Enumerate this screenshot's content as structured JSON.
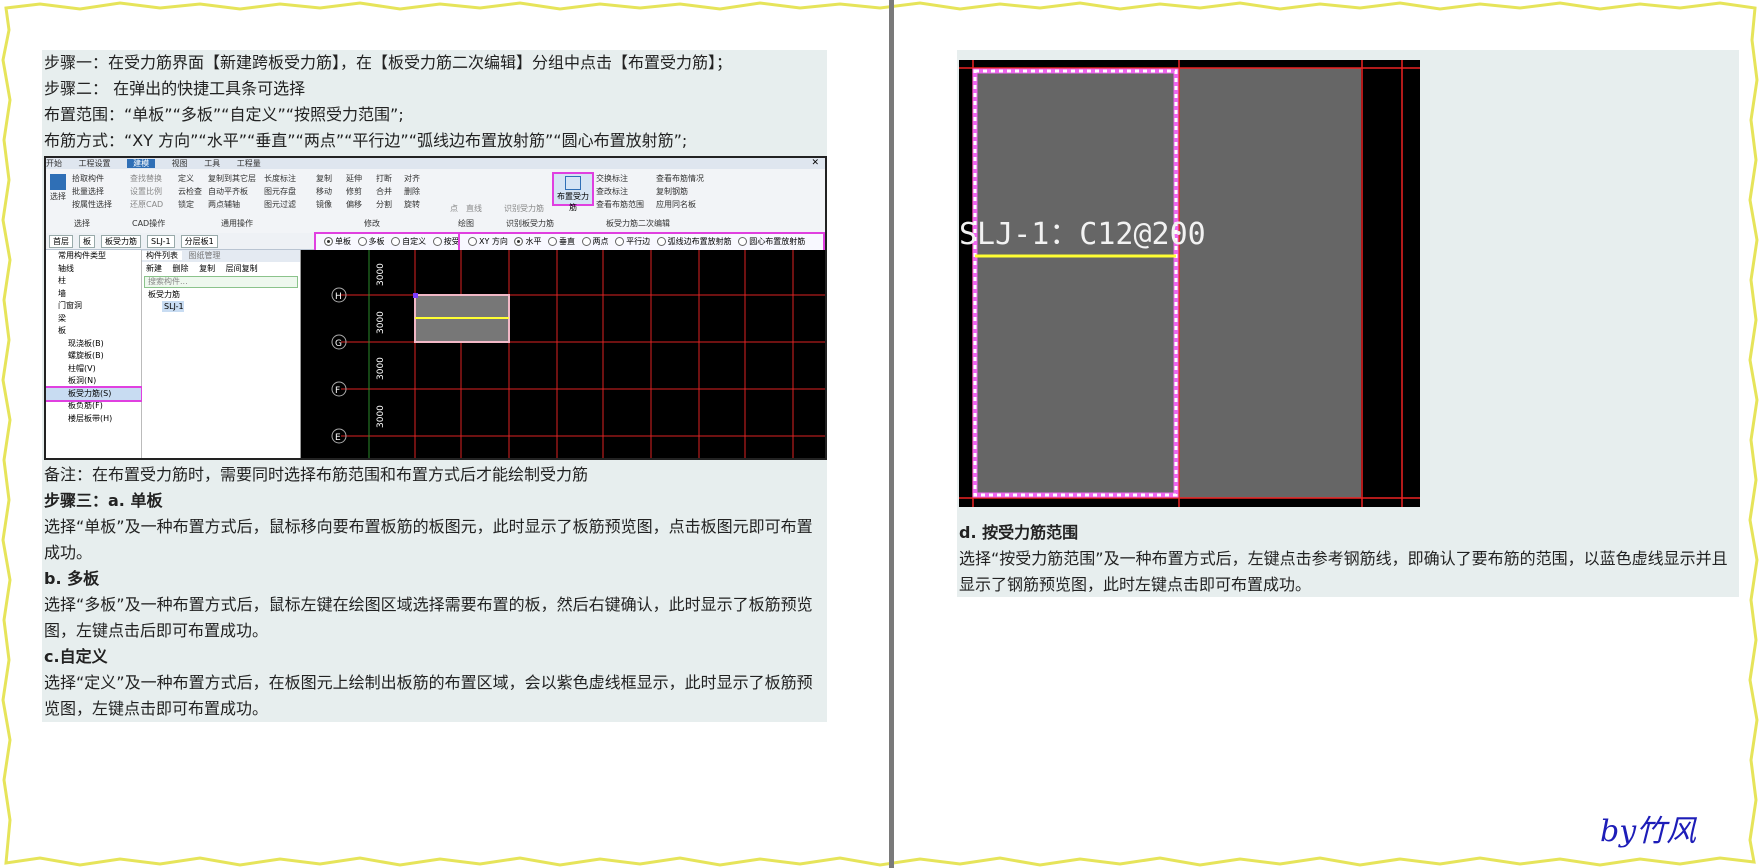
{
  "left": {
    "step1": "步骤一：在受力筋界面【新建跨板受力筋】，在【板受力筋二次编辑】分组中点击【布置受力筋】；",
    "step2": "步骤二：  在弹出的快捷工具条可选择",
    "range": "布置范围：“单板”“多板”“自定义”“按照受力范围”;",
    "method": "布筋方式：“XY 方向”“水平”“垂直”“两点”“平行边”“弧线边布置放射筋”“圆心布置放射筋”;",
    "note": "备注：在布置受力筋时，需要同时选择布筋范围和布置方式后才能绘制受力筋",
    "step3": "步骤三：a. 单板",
    "a_desc": "选择“单板”及一种布置方式后，鼠标移向要布置板筋的板图元，此时显示了板筋预览图，点击板图元即可布置成功。",
    "b_title": " b. 多板",
    "b_desc": "选择“多板”及一种布置方式后，鼠标左键在绘图区域选择需要布置的板，然后右键确认，此时显示了板筋预览图，左键点击后即可布置成功。",
    "c_title": "c.自定义",
    "c_desc": " 选择“定义”及一种布置方式后，在板图元上绘制出板筋的布置区域，会以紫色虚线框显示，此时显示了板筋预览图，左键点击即可布置成功。"
  },
  "screenshot": {
    "menu": [
      "开始",
      "工程设置",
      "建模",
      "视图",
      "工具",
      "工程量"
    ],
    "active_menu": "建模",
    "groups": {
      "select": [
        "拾取构件",
        "批量选择",
        "按属性选择"
      ],
      "select_label": "选择",
      "select_btn": "选择",
      "cad": [
        "查找替换",
        "设置比例",
        "还原CAD"
      ],
      "cad_label": "CAD操作",
      "general": [
        "定义",
        "云检查",
        "锁定",
        "复制到其它层",
        "自动平齐板",
        "两点辅轴",
        "长度标注",
        "图元存盘",
        "图元过滤"
      ],
      "general_label": "通用操作",
      "modify": [
        "复制",
        "移动",
        "镜像",
        "延伸",
        "修剪",
        "偏移",
        "打断",
        "合并",
        "分割",
        "对齐",
        "删除",
        "旋转"
      ],
      "modify_label": "修改",
      "draw": [
        "点",
        "直线"
      ],
      "draw_label": "绘图",
      "identify": "识别受力筋",
      "identify_label": "识别板受力筋",
      "place_btn": "布置受力筋",
      "edit2": [
        "交换标注",
        "查改标注",
        "查看布筋范围",
        "查看布筋情况",
        "复制钢筋",
        "应用同名板"
      ],
      "edit2_label": "板受力筋二次编辑"
    },
    "selectors": [
      "首层",
      "板",
      "板受力筋",
      "SLJ-1",
      "分层板1"
    ],
    "range_opts": [
      "单板",
      "多板",
      "自定义",
      "按受力筋范围"
    ],
    "method_opts": [
      "XY 方向",
      "水平",
      "垂直",
      "两点",
      "平行边",
      "弧线边布置放射筋",
      "圆心布置放射筋"
    ],
    "tree": [
      "常用构件类型",
      "轴线",
      "柱",
      "墙",
      "门窗洞",
      "梁",
      "板",
      "现浇板(B)",
      "螺旋板(B)",
      "柱帽(V)",
      "板洞(N)",
      "板受力筋(S)",
      "板负筋(F)",
      "楼层板带(H)"
    ],
    "list_tabs": [
      "构件列表",
      "图纸管理"
    ],
    "list_tools": [
      "新建",
      "删除",
      "复制",
      "层间复制"
    ],
    "search": "搜索构件...",
    "list_group": "板受力筋",
    "list_item": "SLJ-1",
    "axis_labels": [
      "H",
      "G",
      "F",
      "E"
    ],
    "dims": [
      "3000",
      "3000",
      "3000",
      "3000"
    ]
  },
  "right": {
    "label": "SLJ-1：C12@200",
    "d_title": "d. 按受力筋范围",
    "d_desc": "选择“按受力筋范围”及一种布置方式后，左键点击参考钢筋线，即确认了要布筋的范围，以蓝色虚线显示并且显示了钢筋预览图，此时左键点击即可布置成功。"
  },
  "signature": "by竹风"
}
